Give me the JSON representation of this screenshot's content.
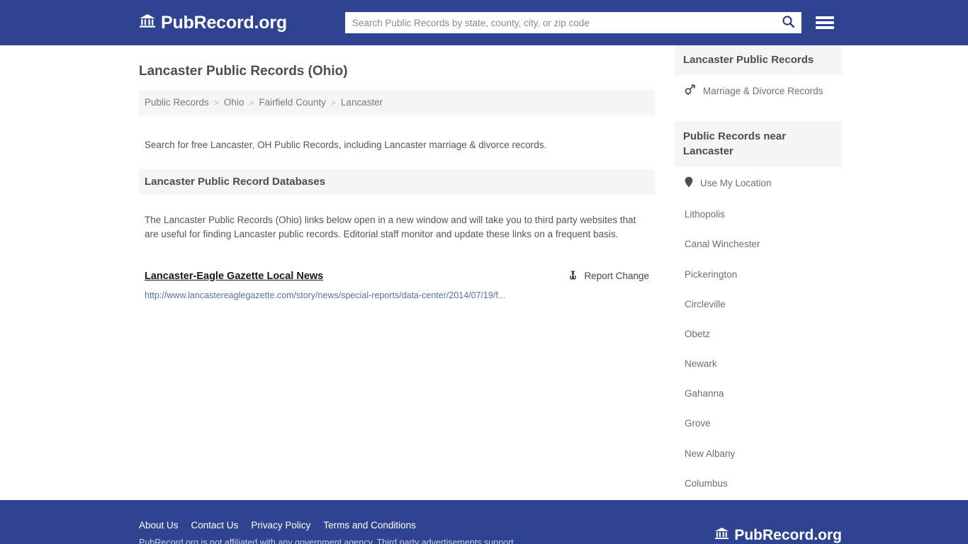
{
  "header": {
    "brand": "PubRecord.org",
    "brand_icon": "bank-institution-icon",
    "search": {
      "placeholder": "Search Public Records by state, county, city, or zip code",
      "value": "",
      "icon": "search-icon"
    },
    "menu_icon": "hamburger-menu-icon",
    "background_color": "#2f4490"
  },
  "main": {
    "page_title": "Lancaster Public Records (Ohio)",
    "breadcrumb": [
      {
        "label": "Public Records"
      },
      {
        "label": "Ohio"
      },
      {
        "label": "Fairfield County"
      },
      {
        "label": "Lancaster"
      }
    ],
    "breadcrumb_separator": ">",
    "intro": "Search for free Lancaster, OH Public Records, including Lancaster marriage & divorce records.",
    "databases_heading": "Lancaster Public Record Databases",
    "databases_body": "The Lancaster Public Records (Ohio) links below open in a new window and will take you to third party websites that are useful for finding Lancaster public records. Editorial staff monitor and update these links on a frequent basis.",
    "results": [
      {
        "title": "Lancaster-Eagle Gazette Local News",
        "url": "http://www.lancastereaglegazette.com/story/news/special-reports/data-center/2014/07/19/f...",
        "report_change_label": "Report Change",
        "report_change_icon": "broken-link-icon"
      }
    ]
  },
  "sidebar": {
    "records_panel": {
      "heading": "Lancaster Public Records",
      "items": [
        {
          "label": "Marriage & Divorce Records",
          "icon": "venus-mars-icon"
        }
      ]
    },
    "nearby_panel": {
      "heading": "Public Records near Lancaster",
      "items": [
        {
          "label": "Use My Location",
          "icon": "map-pin-icon"
        },
        {
          "label": "Lithopolis",
          "icon": ""
        },
        {
          "label": "Canal Winchester",
          "icon": ""
        },
        {
          "label": "Pickerington",
          "icon": ""
        },
        {
          "label": "Circleville",
          "icon": ""
        },
        {
          "label": "Obetz",
          "icon": ""
        },
        {
          "label": "Newark",
          "icon": ""
        },
        {
          "label": "Gahanna",
          "icon": ""
        },
        {
          "label": "Grove",
          "icon": ""
        },
        {
          "label": "New Albany",
          "icon": ""
        },
        {
          "label": "Columbus",
          "icon": ""
        }
      ]
    }
  },
  "footer": {
    "links": [
      {
        "label": "About Us"
      },
      {
        "label": "Contact Us"
      },
      {
        "label": "Privacy Policy"
      },
      {
        "label": "Terms and Conditions"
      }
    ],
    "disclaimer": "PubRecord.org is not affiliated with any government agency. Third party advertisements support",
    "brand": "PubRecord.org",
    "brand_icon": "bank-institution-icon",
    "background_color": "#2f4490"
  }
}
